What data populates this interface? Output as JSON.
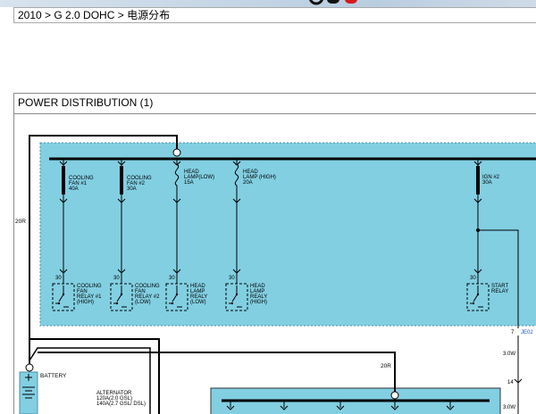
{
  "breadcrumb": {
    "text": "2010 > G 2.0 DOHC > 电源分布"
  },
  "panel": {
    "title": "POWER DISTRIBUTION (1)"
  },
  "colors": {
    "box_fill": "#82cfe2",
    "box_border": "#4f8fa8",
    "wire": "#000000",
    "logo_red": "#d7191c"
  },
  "diagram": {
    "wire_left": "20R",
    "wire_mid": "20R",
    "fuses": [
      {
        "lines": [
          "COOLING",
          "FAN #1",
          "40A"
        ]
      },
      {
        "lines": [
          "COOLING",
          "FAN #2",
          "30A"
        ]
      },
      {
        "lines": [
          "HEAD",
          "LAMP(LOW)",
          "15A"
        ]
      },
      {
        "lines": [
          "HEAD",
          "LAMP (HIGH)",
          "20A"
        ]
      },
      {
        "lines": [
          "IGN #2",
          "30A"
        ]
      }
    ],
    "relays": [
      {
        "pin": "30",
        "lines": [
          "COOLING",
          "FAN",
          "RELAY #1",
          "(HIGH)"
        ]
      },
      {
        "pin": "30",
        "lines": [
          "COOLING",
          "FAN",
          "RELAY #2",
          "(LOW)"
        ]
      },
      {
        "pin": "30",
        "lines": [
          "HEAD",
          "LAMP",
          "REALY",
          "(LOW)"
        ]
      },
      {
        "pin": "30",
        "lines": [
          "HEAD",
          "LAMP",
          "REALY",
          "(HIGH)"
        ]
      },
      {
        "pin": "30",
        "lines": [
          "START",
          "RELAY"
        ]
      }
    ],
    "connector": {
      "pin": "7",
      "id": "JE02"
    },
    "wire_labels": [
      "3.0W",
      "3.0W"
    ],
    "pin_14": "14",
    "battery": "BATTERY",
    "alternator": [
      "ALTERNATOR",
      "120A(2.0 GSL)",
      "140A(2.7 GSL/ DSL)"
    ]
  }
}
